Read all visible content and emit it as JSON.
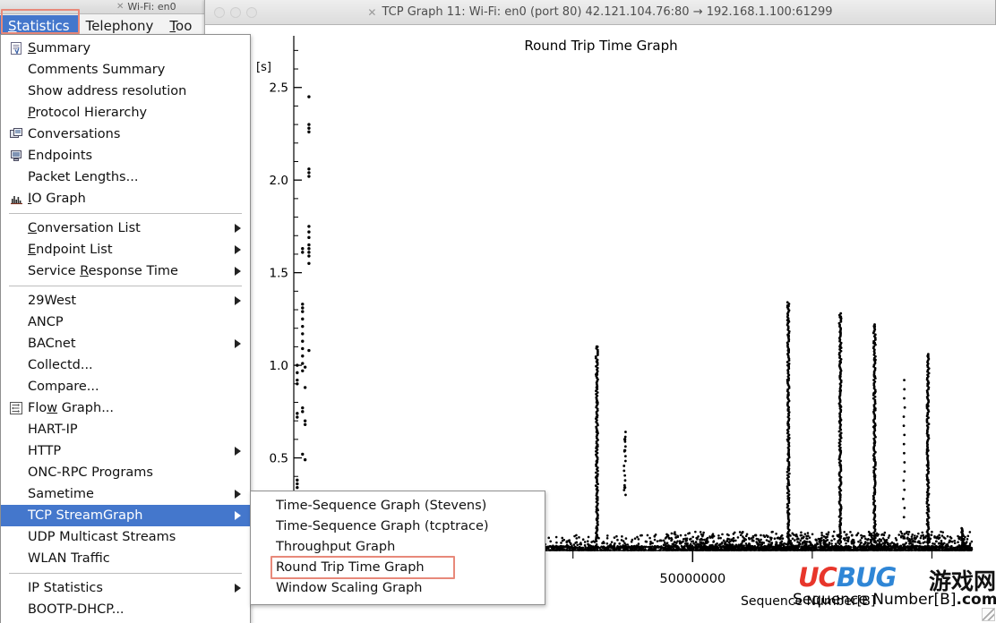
{
  "background_window": {
    "title": "Wi-Fi: en0",
    "close_icon": "x-icon",
    "menubar": [
      {
        "label": "Statistics",
        "mnemonic": "S",
        "active": true
      },
      {
        "label": "Telephony",
        "mnemonic": "T",
        "active": false
      },
      {
        "label": "Too",
        "mnemonic": "T",
        "active": false
      }
    ]
  },
  "graph_window": {
    "title": "TCP Graph 11: Wi-Fi: en0 (port 80) 42.121.104.76:80 → 192.168.1.100:61299",
    "close_icon": "x-icon"
  },
  "statistics_menu": {
    "items": [
      {
        "label": "Summary",
        "icon": "summary-icon",
        "mnemonic": "S",
        "submenu": false,
        "selected": false
      },
      {
        "label": "Comments Summary",
        "icon": null,
        "mnemonic": "",
        "submenu": false,
        "selected": false
      },
      {
        "label": "Show address resolution",
        "icon": null,
        "mnemonic": "",
        "submenu": false,
        "selected": false
      },
      {
        "label": "Protocol Hierarchy",
        "icon": null,
        "mnemonic": "P",
        "submenu": false,
        "selected": false
      },
      {
        "label": "Conversations",
        "icon": "conversations-icon",
        "mnemonic": "",
        "submenu": false,
        "selected": false
      },
      {
        "label": "Endpoints",
        "icon": "endpoints-icon",
        "mnemonic": "",
        "submenu": false,
        "selected": false
      },
      {
        "label": "Packet Lengths...",
        "icon": null,
        "mnemonic": "",
        "submenu": false,
        "selected": false
      },
      {
        "label": "IO Graph",
        "icon": "io-graph-icon",
        "mnemonic": "I",
        "submenu": false,
        "selected": false
      },
      {
        "separator": true
      },
      {
        "label": "Conversation List",
        "icon": null,
        "mnemonic": "C",
        "submenu": true,
        "selected": false
      },
      {
        "label": "Endpoint List",
        "icon": null,
        "mnemonic": "E",
        "submenu": true,
        "selected": false
      },
      {
        "label": "Service Response Time",
        "icon": null,
        "mnemonic": "R",
        "submenu": true,
        "selected": false
      },
      {
        "separator": true
      },
      {
        "label": "29West",
        "icon": null,
        "mnemonic": "",
        "submenu": true,
        "selected": false
      },
      {
        "label": "ANCP",
        "icon": null,
        "mnemonic": "",
        "submenu": false,
        "selected": false
      },
      {
        "label": "BACnet",
        "icon": null,
        "mnemonic": "",
        "submenu": true,
        "selected": false
      },
      {
        "label": "Collectd...",
        "icon": null,
        "mnemonic": "",
        "submenu": false,
        "selected": false
      },
      {
        "label": "Compare...",
        "icon": null,
        "mnemonic": "",
        "submenu": false,
        "selected": false
      },
      {
        "label": "Flow Graph...",
        "icon": "flow-graph-icon",
        "mnemonic": "w",
        "submenu": false,
        "selected": false
      },
      {
        "label": "HART-IP",
        "icon": null,
        "mnemonic": "",
        "submenu": false,
        "selected": false
      },
      {
        "label": "HTTP",
        "icon": null,
        "mnemonic": "",
        "submenu": true,
        "selected": false
      },
      {
        "label": "ONC-RPC Programs",
        "icon": null,
        "mnemonic": "",
        "submenu": false,
        "selected": false
      },
      {
        "label": "Sametime",
        "icon": null,
        "mnemonic": "",
        "submenu": true,
        "selected": false
      },
      {
        "label": "TCP StreamGraph",
        "icon": null,
        "mnemonic": "",
        "submenu": true,
        "selected": true
      },
      {
        "label": "UDP Multicast Streams",
        "icon": null,
        "mnemonic": "",
        "submenu": false,
        "selected": false
      },
      {
        "label": "WLAN Traffic",
        "icon": null,
        "mnemonic": "",
        "submenu": false,
        "selected": false
      },
      {
        "separator": true
      },
      {
        "label": "IP Statistics",
        "icon": null,
        "mnemonic": "",
        "submenu": true,
        "selected": false
      },
      {
        "label": "BOOTP-DHCP...",
        "icon": null,
        "mnemonic": "",
        "submenu": false,
        "selected": false
      }
    ]
  },
  "tcp_streamgraph_submenu": {
    "items": [
      {
        "label": "Time-Sequence Graph (Stevens)",
        "highlighted": false
      },
      {
        "label": "Time-Sequence Graph (tcptrace)",
        "highlighted": false
      },
      {
        "label": "Throughput Graph",
        "highlighted": false
      },
      {
        "label": "Round Trip Time Graph",
        "highlighted": true
      },
      {
        "label": "Window Scaling Graph",
        "highlighted": false
      }
    ]
  },
  "watermark": {
    "uc": "UC",
    "bug": "BUG",
    "cn": "游戏网",
    "site": "Sequence Number[B]",
    "com": ".com"
  },
  "colors": {
    "menu_highlight": "#4477cc",
    "annotation": "#e8897a",
    "scrollbar_thumb": "#3f86d4",
    "plot_ink": "#000000"
  },
  "chart_data": {
    "type": "scatter",
    "title": "Round Trip Time Graph",
    "xlabel": "Sequence Number[B]",
    "ylabel": "[s]",
    "yunit": "[s]",
    "grid": false,
    "legend": null,
    "xlim": [
      0,
      85000000
    ],
    "ylim": [
      0,
      2.75
    ],
    "ytick_labels": [
      "0.5",
      "1.0",
      "1.5",
      "2.0",
      "2.5"
    ],
    "ytick_values": [
      0.5,
      1.0,
      1.5,
      2.0,
      2.5
    ],
    "yminor_step": 0.1,
    "xtick_labels": [
      "",
      "",
      "50000000",
      "",
      ""
    ],
    "xtick_values": [
      20000000,
      35000000,
      50000000,
      65000000,
      80000000
    ],
    "series": [
      {
        "name": "Round Trip Time",
        "marker": "dot",
        "color": "#000000",
        "points": [
          [
            1900000,
            2.45
          ],
          [
            1900000,
            2.28
          ],
          [
            1900000,
            2.26
          ],
          [
            1900000,
            2.3
          ],
          [
            1900000,
            2.04
          ],
          [
            1900000,
            2.02
          ],
          [
            1900000,
            2.06
          ],
          [
            1900000,
            1.75
          ],
          [
            1900000,
            1.72
          ],
          [
            1900000,
            1.69
          ],
          [
            1900000,
            1.65
          ],
          [
            1900000,
            1.63
          ],
          [
            1900000,
            1.61
          ],
          [
            1900000,
            1.59
          ],
          [
            1900000,
            1.55
          ],
          [
            1900000,
            1.08
          ],
          [
            1100000,
            1.63
          ],
          [
            1100000,
            1.61
          ],
          [
            1100000,
            1.33
          ],
          [
            1100000,
            1.31
          ],
          [
            1100000,
            1.29
          ],
          [
            1100000,
            1.25
          ],
          [
            1100000,
            1.21
          ],
          [
            1100000,
            1.17
          ],
          [
            1100000,
            1.13
          ],
          [
            1100000,
            1.09
          ],
          [
            1100000,
            1.05
          ],
          [
            1100000,
            1.01
          ],
          [
            1100000,
            0.97
          ],
          [
            1100000,
            0.77
          ],
          [
            1100000,
            0.75
          ],
          [
            1100000,
            0.52
          ],
          [
            430000,
            1.0
          ],
          [
            430000,
            0.96
          ],
          [
            430000,
            0.92
          ],
          [
            430000,
            0.9
          ],
          [
            430000,
            0.74
          ],
          [
            430000,
            0.72
          ],
          [
            430000,
            0.38
          ],
          [
            430000,
            0.36
          ],
          [
            430000,
            0.34
          ],
          [
            430000,
            0.3
          ],
          [
            1420000,
            0.99
          ],
          [
            1420000,
            0.88
          ],
          [
            1420000,
            0.7
          ],
          [
            1420000,
            0.68
          ],
          [
            1420000,
            0.49
          ],
          [
            38000000,
            1.1
          ],
          [
            38000000,
            1.02
          ],
          [
            38000000,
            0.95
          ],
          [
            38000000,
            0.88
          ],
          [
            38000000,
            0.8
          ],
          [
            38000000,
            0.72
          ],
          [
            38000000,
            0.64
          ],
          [
            38000000,
            0.56
          ],
          [
            38000000,
            0.48
          ],
          [
            38000000,
            0.4
          ],
          [
            38000000,
            0.33
          ],
          [
            38000000,
            0.28
          ],
          [
            38000000,
            0.22
          ],
          [
            38000000,
            0.17
          ],
          [
            38000000,
            0.12
          ],
          [
            41500000,
            0.6
          ],
          [
            41500000,
            0.54
          ],
          [
            41500000,
            0.34
          ],
          [
            62000000,
            1.32
          ],
          [
            62000000,
            1.24
          ],
          [
            62000000,
            1.16
          ],
          [
            62000000,
            1.08
          ],
          [
            62000000,
            1.0
          ],
          [
            62000000,
            0.92
          ],
          [
            62000000,
            0.84
          ],
          [
            62000000,
            0.76
          ],
          [
            62000000,
            0.68
          ],
          [
            62000000,
            0.6
          ],
          [
            62000000,
            0.52
          ],
          [
            62000000,
            0.44
          ],
          [
            62000000,
            0.36
          ],
          [
            62000000,
            0.28
          ],
          [
            62000000,
            0.2
          ],
          [
            62000000,
            0.14
          ],
          [
            62000000,
            0.08
          ],
          [
            68500000,
            1.26
          ],
          [
            68500000,
            1.18
          ],
          [
            68500000,
            1.1
          ],
          [
            68500000,
            1.02
          ],
          [
            68500000,
            0.94
          ],
          [
            68500000,
            0.86
          ],
          [
            68500000,
            0.78
          ],
          [
            68500000,
            0.7
          ],
          [
            68500000,
            0.62
          ],
          [
            68500000,
            0.54
          ],
          [
            68500000,
            0.46
          ],
          [
            68500000,
            0.38
          ],
          [
            68500000,
            0.3
          ],
          [
            68500000,
            0.22
          ],
          [
            68500000,
            0.14
          ],
          [
            72800000,
            1.21
          ],
          [
            72800000,
            1.12
          ],
          [
            72800000,
            1.03
          ],
          [
            72800000,
            0.94
          ],
          [
            72800000,
            0.85
          ],
          [
            72800000,
            0.76
          ],
          [
            72800000,
            0.67
          ],
          [
            72800000,
            0.58
          ],
          [
            72800000,
            0.49
          ],
          [
            72800000,
            0.4
          ],
          [
            72800000,
            0.31
          ],
          [
            72800000,
            0.22
          ],
          [
            72800000,
            0.13
          ],
          [
            79500000,
            1.05
          ],
          [
            79500000,
            0.9
          ],
          [
            79500000,
            0.78
          ],
          [
            79500000,
            0.62
          ],
          [
            79500000,
            0.54
          ],
          [
            79500000,
            0.46
          ],
          [
            79500000,
            0.38
          ],
          [
            79500000,
            0.3
          ],
          [
            79500000,
            0.22
          ],
          [
            79500000,
            0.14
          ],
          [
            79500000,
            0.08
          ],
          [
            84000000,
            0.06
          ],
          [
            84000000,
            0.04
          ],
          [
            84000000,
            0.03
          ]
        ],
        "baseline_note": "dense near-zero band of points spanning the full sequence-number range"
      }
    ]
  }
}
